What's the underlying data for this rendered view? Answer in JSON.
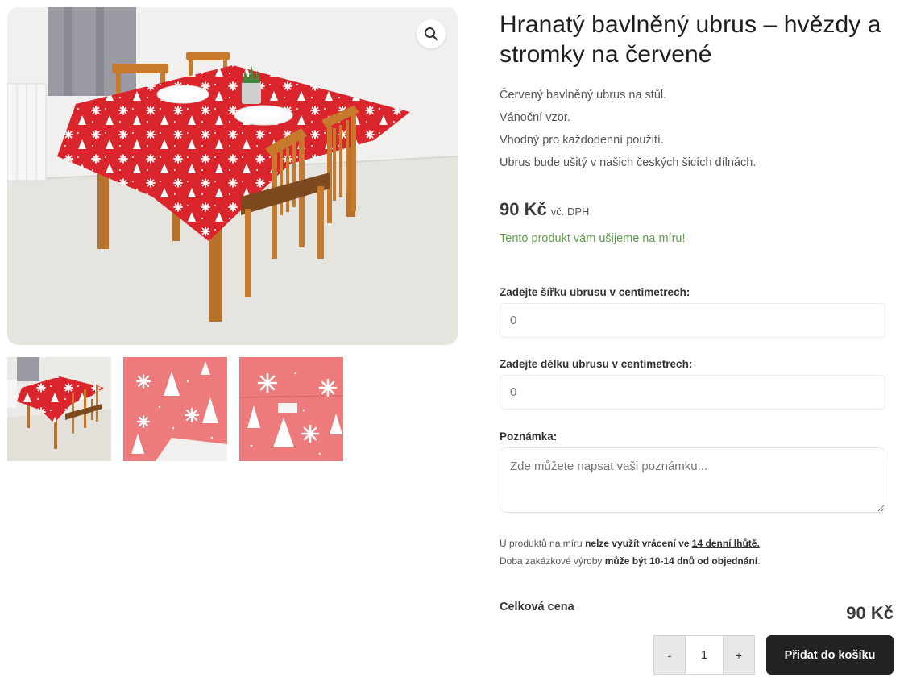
{
  "gallery": {
    "zoom_icon": "magnifier-icon",
    "thumbnails": [
      "thumb-table-scene",
      "thumb-fabric-corner",
      "thumb-fabric-detail"
    ]
  },
  "product": {
    "title": "Hranatý bavlněný ubrus – hvězdy a stromky na červené",
    "description": [
      "Červený bavlněný ubrus na stůl.",
      "Vánoční vzor.",
      "Vhodný pro každodenní použití.",
      "Ubrus bude ušitý v našich českých šicích dílnách."
    ],
    "price": "90 Kč",
    "vat_label": "vč. DPH",
    "custom_note": "Tento produkt vám ušijeme na míru!"
  },
  "form": {
    "width_label": "Zadejte šířku ubrusu v centimetrech:",
    "width_placeholder": "0",
    "length_label": "Zadejte délku ubrusu v centimetrech:",
    "length_placeholder": "0",
    "note_label": "Poznámka:",
    "note_placeholder": "Zde můžete napsat vaši poznámku..."
  },
  "info": {
    "line1_prefix": "U produktů na míru ",
    "line1_bold": "nelze využít vrácení ve ",
    "line1_link": "14 denní lhůtě.",
    "line2_prefix": "Doba zakázkové výroby ",
    "line2_bold": "může být 10-14 dnů od objednání",
    "line2_suffix": "."
  },
  "total": {
    "label": "Celková cena",
    "value": "90 Kč"
  },
  "cart": {
    "minus_label": "-",
    "quantity": "1",
    "plus_label": "+",
    "add_label": "Přidat do košíku"
  },
  "colors": {
    "cloth_red": "#d9252b",
    "accent_green": "#5e9e4c",
    "button_dark": "#222222"
  }
}
